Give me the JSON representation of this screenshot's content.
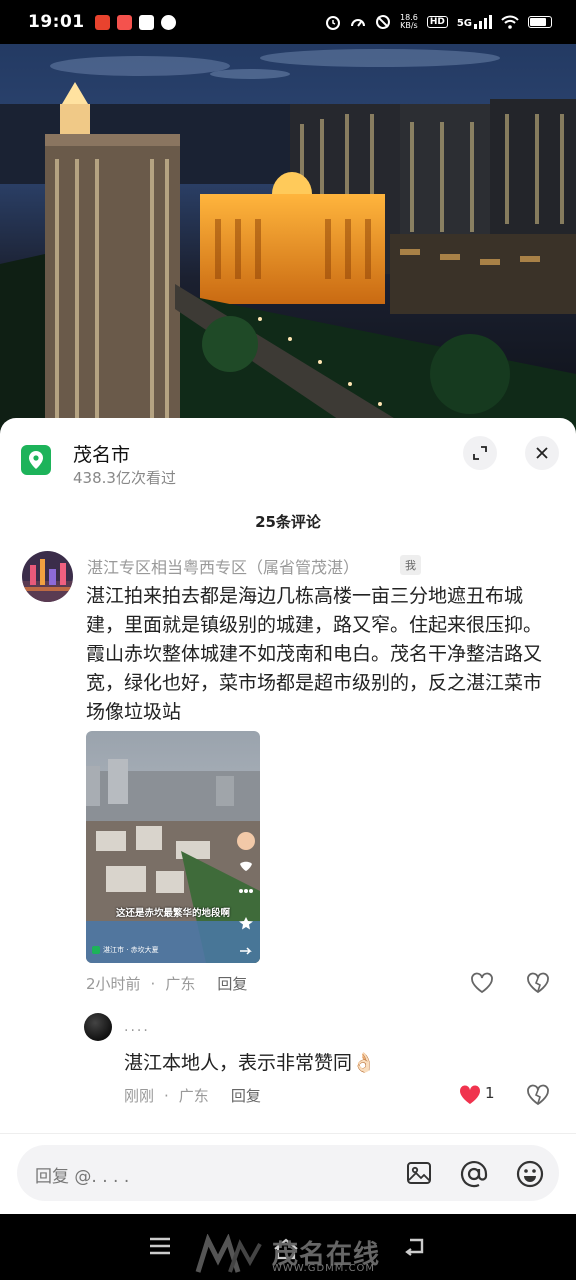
{
  "status_bar": {
    "time": "19:01",
    "net_speed_value": "18.6",
    "net_speed_unit": "KB/s",
    "hd_badge": "HD",
    "network": "5G"
  },
  "location": {
    "title": "茂名市",
    "views": "438.3亿次看过"
  },
  "comments_header": "25条评论",
  "comment": {
    "author": "湛江专区相当粤西专区（属省管茂湛）",
    "me_tag": "我",
    "text": "湛江拍来拍去都是海边几栋高楼一亩三分地遮丑布城建，里面就是镇级别的城建，路又窄。住起来很压抑。霞山赤坎整体城建不如茂南和电白。茂名干净整洁路又宽，绿化也好，菜市场都是超市级别的，反之湛江菜市场像垃圾站",
    "image_caption": "这还是赤坎最繁华的地段啊",
    "image_footer": "湛江市 · 赤坎大夏",
    "time": "2小时前",
    "region": "广东",
    "reply_label": "回复"
  },
  "sub_comment": {
    "author": "....",
    "text": "湛江本地人，表示非常赞同👌🏻",
    "time": "刚刚",
    "region": "广东",
    "reply_label": "回复",
    "like_count": "1"
  },
  "input": {
    "placeholder": "回复 @. . . ."
  },
  "watermark": {
    "name": "茂名在线",
    "url": "WWW.GDMM.COM"
  },
  "colors": {
    "location_green": "#1db35a",
    "like_red": "#f0334e"
  }
}
